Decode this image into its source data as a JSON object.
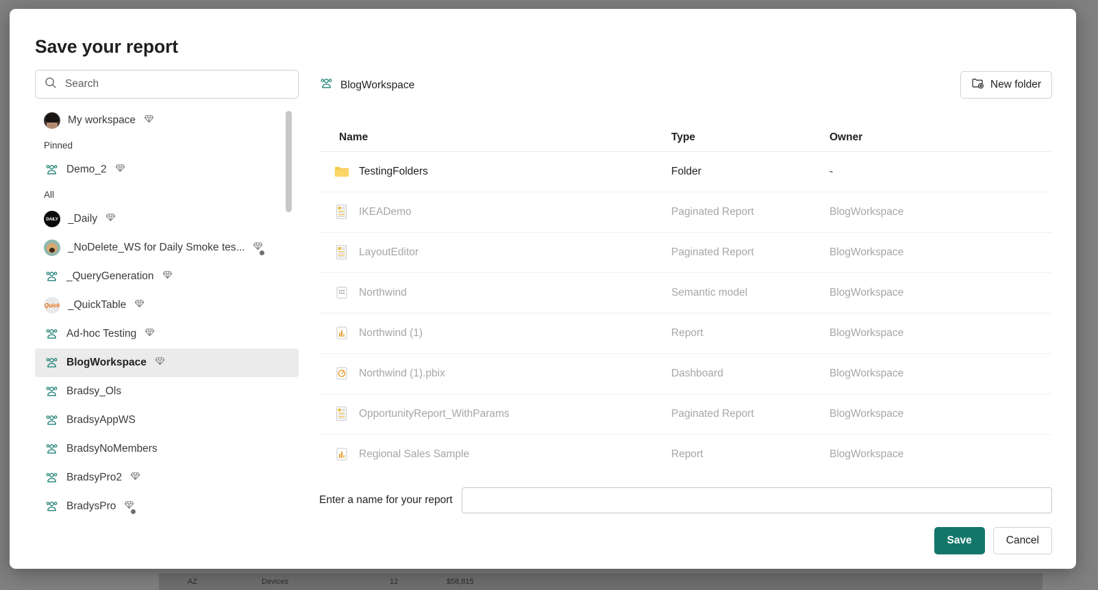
{
  "colors": {
    "save_button": "#12776a",
    "workspace_icon": "#1a7f74",
    "folder_icon": "#f7c94b",
    "selected_row": "#ebebeb",
    "backdrop": "#808080"
  },
  "dialog": {
    "title": "Save your report"
  },
  "search": {
    "placeholder": "Search",
    "value": "",
    "icon": "search-icon"
  },
  "sidebar": {
    "my_workspace": {
      "label": "My workspace",
      "icon": "avatar-person",
      "badge": "gem-icon"
    },
    "groups": [
      {
        "label": "Pinned",
        "items": [
          {
            "label": "Demo_2",
            "icon": "workspace-icon",
            "badge": "gem-icon",
            "selected": false
          }
        ]
      },
      {
        "label": "All",
        "items": [
          {
            "label": "_Daily",
            "icon": "avatar-daily",
            "avatar_text": "DAILY",
            "badge": "gem-icon",
            "selected": false
          },
          {
            "label": "_NoDelete_WS for Daily Smoke tes...",
            "icon": "avatar-dog",
            "badge": "gem-shared-icon",
            "selected": false
          },
          {
            "label": "_QueryGeneration",
            "icon": "workspace-icon",
            "badge": "gem-icon",
            "selected": false
          },
          {
            "label": "_QuickTable",
            "icon": "avatar-quick",
            "avatar_text": "Quick",
            "badge": "gem-icon",
            "selected": false
          },
          {
            "label": "Ad-hoc Testing",
            "icon": "workspace-icon",
            "badge": "gem-icon",
            "selected": false
          },
          {
            "label": "BlogWorkspace",
            "icon": "workspace-icon",
            "badge": "gem-icon",
            "selected": true
          },
          {
            "label": "Bradsy_Ols",
            "icon": "workspace-icon",
            "badge": "",
            "selected": false
          },
          {
            "label": "BradsyAppWS",
            "icon": "workspace-icon",
            "badge": "",
            "selected": false
          },
          {
            "label": "BradsyNoMembers",
            "icon": "workspace-icon",
            "badge": "",
            "selected": false
          },
          {
            "label": "BradsyPro2",
            "icon": "workspace-icon",
            "badge": "gem-icon",
            "selected": false
          },
          {
            "label": "BradysPro",
            "icon": "workspace-icon",
            "badge": "gem-shared-icon",
            "selected": false
          }
        ]
      }
    ]
  },
  "breadcrumb": {
    "label": "BlogWorkspace",
    "icon": "workspace-icon"
  },
  "toolbar": {
    "new_folder_label": "New folder",
    "new_folder_icon": "new-folder-icon"
  },
  "table": {
    "columns": {
      "name": "Name",
      "type": "Type",
      "owner": "Owner"
    },
    "rows": [
      {
        "name": "TestingFolders",
        "type": "Folder",
        "owner": "-",
        "icon": "folder-icon",
        "disabled": false
      },
      {
        "name": "IKEADemo",
        "type": "Paginated Report",
        "owner": "BlogWorkspace",
        "icon": "paginated-report-icon",
        "disabled": true
      },
      {
        "name": "LayoutEditor",
        "type": "Paginated Report",
        "owner": "BlogWorkspace",
        "icon": "paginated-report-icon",
        "disabled": true
      },
      {
        "name": "Northwind",
        "type": "Semantic model",
        "owner": "BlogWorkspace",
        "icon": "semantic-model-icon",
        "disabled": true
      },
      {
        "name": "Northwind (1)",
        "type": "Report",
        "owner": "BlogWorkspace",
        "icon": "report-icon",
        "disabled": true
      },
      {
        "name": "Northwind (1).pbix",
        "type": "Dashboard",
        "owner": "BlogWorkspace",
        "icon": "dashboard-icon",
        "disabled": true
      },
      {
        "name": "OpportunityReport_WithParams",
        "type": "Paginated Report",
        "owner": "BlogWorkspace",
        "icon": "paginated-report-icon",
        "disabled": true
      },
      {
        "name": "Regional Sales Sample",
        "type": "Report",
        "owner": "BlogWorkspace",
        "icon": "report-icon",
        "disabled": true
      }
    ]
  },
  "name_field": {
    "label": "Enter a name for your report",
    "value": "",
    "placeholder": ""
  },
  "actions": {
    "save_label": "Save",
    "cancel_label": "Cancel"
  },
  "background_app": {
    "row": {
      "state": "AZ",
      "category": "Devices",
      "count": "12",
      "amount": "$58,815"
    }
  }
}
